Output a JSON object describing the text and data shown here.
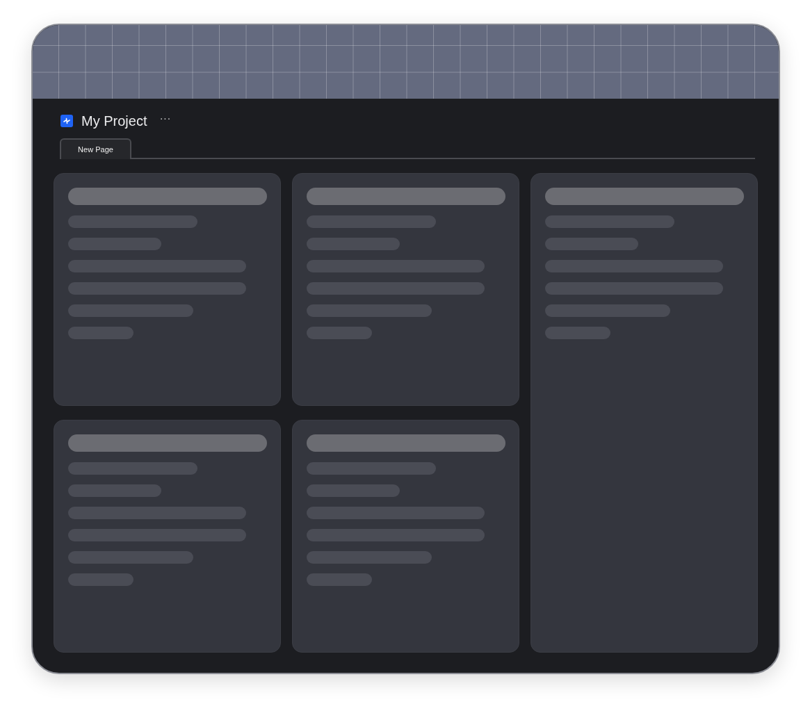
{
  "project": {
    "title": "My Project",
    "menu_icon": "···"
  },
  "tabs": [
    {
      "label": "New Page",
      "selected": true
    }
  ],
  "columns": [
    {
      "cards": [
        {
          "kind": "skeleton"
        },
        {
          "kind": "skeleton"
        }
      ]
    },
    {
      "cards": [
        {
          "kind": "skeleton"
        },
        {
          "kind": "skeleton"
        }
      ]
    },
    {
      "cards": [
        {
          "kind": "skeleton"
        }
      ]
    }
  ]
}
